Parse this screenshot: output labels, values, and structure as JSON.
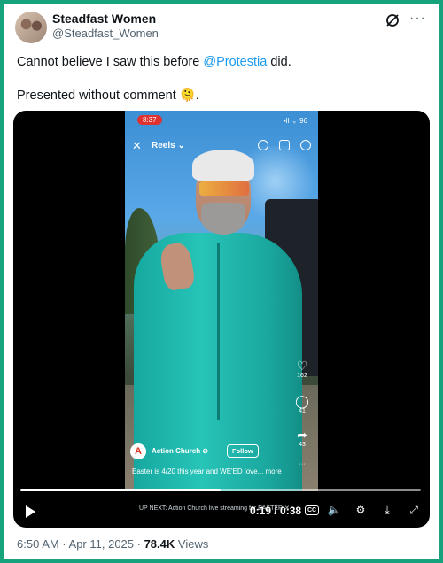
{
  "tweet": {
    "name": "Steadfast Women",
    "handle": "@Steadfast_Women",
    "text_before": "Cannot believe I saw this before ",
    "mention": "@Protestia",
    "text_after": " did.",
    "line2": "Presented without comment 🫠."
  },
  "video": {
    "status_time": "8:37",
    "signal": "•ll ᯤ 96",
    "reels_label": "Reels ⌄",
    "likes": "162",
    "comments": "41",
    "shares": "43",
    "account_initial": "A",
    "account_name": "Action Church ⊘",
    "follow_label": "Follow",
    "caption": "Easter is 4/20 this year and WE'ED love... more",
    "up_next": "UP NEXT: Action Church live streaming for EASTER ✕",
    "time_display": "0:19 / 0:38",
    "progress_fraction": 0.5,
    "cc_label": "CC"
  },
  "footer": {
    "timestamp": "6:50 AM · Apr 11, 2025 · ",
    "views_count": "78.4K",
    "views_label": " Views"
  }
}
